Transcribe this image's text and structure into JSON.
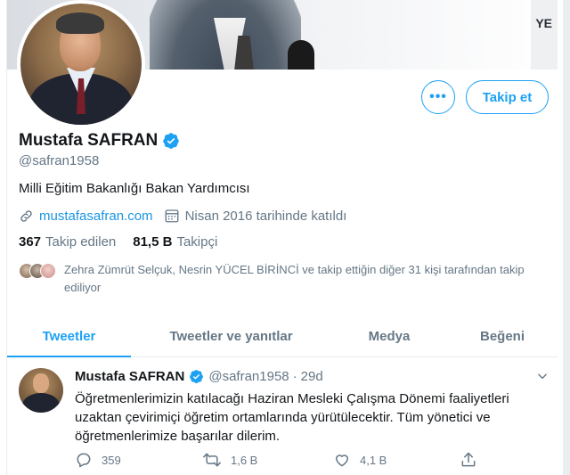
{
  "banner": {
    "sign_text": "YE"
  },
  "actions": {
    "more_label": "•••",
    "follow_label": "Takip et"
  },
  "profile": {
    "name": "Mustafa SAFRAN",
    "handle": "@safran1958",
    "bio": "Milli Eğitim Bakanlığı Bakan Yardımcısı",
    "website": "mustafasafran.com",
    "joined": "Nisan 2016 tarihinde katıldı",
    "following_count": "367",
    "following_label": "Takip edilen",
    "followers_count": "81,5 B",
    "followers_label": "Takipçi",
    "followed_by": "Zehra Zümrüt Selçuk, Nesrin YÜCEL BİRİNCİ ve takip ettiğin diğer 31 kişi tarafından takip ediliyor"
  },
  "tabs": [
    {
      "label": "Tweetler",
      "active": true
    },
    {
      "label": "Tweetler ve yanıtlar",
      "active": false
    },
    {
      "label": "Medya",
      "active": false
    },
    {
      "label": "Beğeni",
      "active": false
    }
  ],
  "tweet": {
    "name": "Mustafa SAFRAN",
    "handle": "@safran1958",
    "separator": "·",
    "time": "29d",
    "text": "Öğretmenlerimizin katılacağı Haziran Mesleki Çalışma Dönemi faaliyetleri uzaktan çevirimiçi öğretim ortamlarında yürütülecektir. Tüm yönetici ve öğretmenlerimize başarılar dilerim.",
    "replies": "359",
    "retweets": "1,6 B",
    "likes": "4,1 B"
  },
  "colors": {
    "accent": "#1da1f2",
    "link": "#1b95e0",
    "muted": "#657786",
    "text": "#14171a"
  },
  "icons": [
    "verified-badge-icon",
    "link-icon",
    "calendar-icon",
    "reply-icon",
    "retweet-icon",
    "like-icon",
    "share-icon",
    "chevron-down-icon"
  ]
}
